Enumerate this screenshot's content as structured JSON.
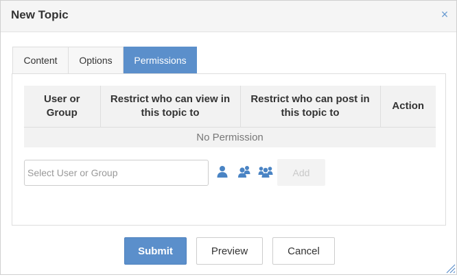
{
  "dialog": {
    "title": "New Topic",
    "close_symbol": "×"
  },
  "tabs": [
    {
      "label": "Content",
      "active": false
    },
    {
      "label": "Options",
      "active": false
    },
    {
      "label": "Permissions",
      "active": true
    }
  ],
  "permissions": {
    "columns": [
      "User or Group",
      "Restrict who can view in this topic to",
      "Restrict who can post in this topic to",
      "Action"
    ],
    "empty_text": "No Permission",
    "select_placeholder": "Select User or Group",
    "select_value": "",
    "icons": [
      "user-icon",
      "user-group-icon",
      "users-icon"
    ],
    "add_label": "Add"
  },
  "footer": {
    "submit_label": "Submit",
    "preview_label": "Preview",
    "cancel_label": "Cancel"
  },
  "colors": {
    "accent": "#5b8fcb",
    "icon": "#4a84c4",
    "header_bg": "#f5f5f5",
    "table_header_bg": "#f2f2f2"
  }
}
